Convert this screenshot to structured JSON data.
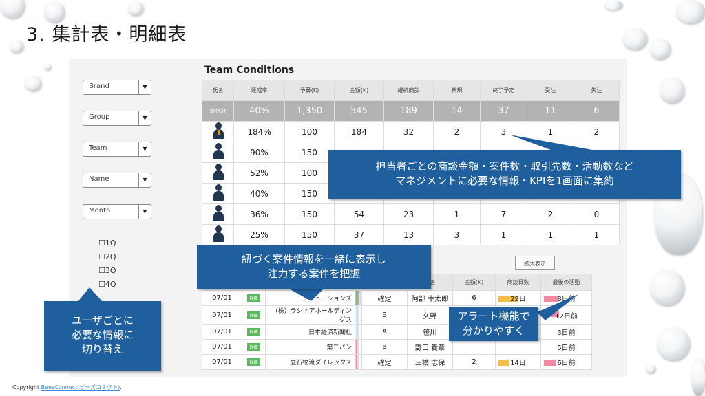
{
  "title": "3. 集計表・明細表",
  "filters": {
    "dropdowns": [
      "Brand",
      "Group",
      "Team",
      "Name",
      "Month"
    ],
    "quarters": [
      "1Q",
      "2Q",
      "3Q",
      "4Q"
    ]
  },
  "team_conditions": {
    "title": "Team Conditions",
    "headers": [
      "氏名",
      "達成率",
      "予算(K)",
      "金額(K)",
      "継続商談",
      "新規",
      "終了予定",
      "受注",
      "失注"
    ],
    "total_row": [
      "総合計",
      "40%",
      "1,350",
      "545",
      "189",
      "14",
      "37",
      "11",
      "6"
    ],
    "rows": [
      [
        "184%",
        "100",
        "184",
        "32",
        "2",
        "3",
        "1",
        "2"
      ],
      [
        "90%",
        "150",
        "",
        "",
        "",
        "",
        "",
        ""
      ],
      [
        "52%",
        "100",
        "",
        "",
        "",
        "",
        "",
        ""
      ],
      [
        "40%",
        "150",
        "",
        "",
        "",
        "",
        "",
        ""
      ],
      [
        "36%",
        "150",
        "54",
        "23",
        "1",
        "7",
        "2",
        "0"
      ],
      [
        "25%",
        "150",
        "37",
        "13",
        "3",
        "1",
        "1",
        "1"
      ]
    ]
  },
  "zoom_button": "拡大表示",
  "detail": {
    "headers": [
      "",
      "",
      "",
      "",
      "",
      "氏名",
      "金額(K)",
      "商談日数",
      "最後の活動"
    ],
    "badge": "詳細",
    "rows": [
      {
        "date": "07/01",
        "company": "ソリューションズ",
        "rank": "確定",
        "name": "阿部 幸太郎",
        "amount": "6",
        "days": "29日",
        "last": "8日前"
      },
      {
        "date": "07/01",
        "company": "（株）ラシィアホールディングス",
        "rank": "B",
        "name": "久野",
        "amount": "",
        "days": "",
        "last": "12日前"
      },
      {
        "date": "07/01",
        "company": "日本経済新聞社",
        "rank": "A",
        "name": "笹川",
        "amount": "",
        "days": "",
        "last": "3日前"
      },
      {
        "date": "07/01",
        "company": "第二パン",
        "rank": "B",
        "name": "野口 貴章",
        "amount": "",
        "days": "",
        "last": "5日前"
      },
      {
        "date": "07/01",
        "company": "立石物流ダイレックス",
        "rank": "確定",
        "name": "三橋 志保",
        "amount": "2",
        "days": "14日",
        "last": "6日前"
      }
    ]
  },
  "callouts": {
    "top": [
      "担当者ごとの商談金額・案件数・取引先数・活動数など",
      "マネジメントに必要な情報・KPIを1画面に集約"
    ],
    "middle": [
      "紐づく案件情報を一緒に表示し",
      "注力する案件を把握"
    ],
    "left": [
      "ユーザごとに",
      "必要な情報に",
      "切り替え"
    ],
    "right": [
      "アラート機能で",
      "分かりやすく"
    ]
  },
  "copyright": {
    "prefix": "Copyright",
    "link": "BeesConnect(ビーズコネクト)",
    "suffix": "."
  }
}
